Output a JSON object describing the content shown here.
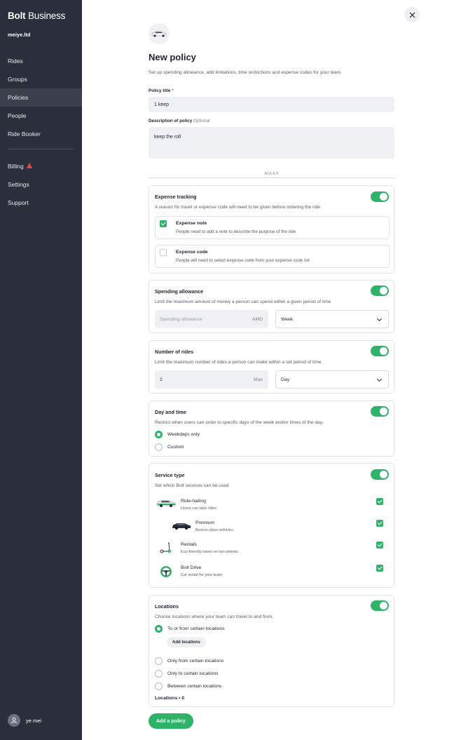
{
  "app": {
    "brand_bold": "Bolt",
    "brand_rest": " Business",
    "org": "meiye.ltd"
  },
  "sidebar": {
    "items": [
      {
        "label": "Rides"
      },
      {
        "label": "Groups"
      },
      {
        "label": "Policies",
        "active": true
      },
      {
        "label": "People"
      },
      {
        "label": "Ride Booker"
      }
    ],
    "secondary": [
      {
        "label": "Billing",
        "warning": true
      },
      {
        "label": "Settings"
      },
      {
        "label": "Support"
      }
    ],
    "user_name": "ye mei"
  },
  "page": {
    "title": "New policy",
    "subtitle": "Set up spending allowance, add limitations, time restrictions and expense codes for your team.",
    "policy_title_label": "Policy title",
    "policy_title_required": "*",
    "policy_title_value": "1 keep",
    "description_label": "Description of policy",
    "description_optional": "Optional",
    "description_value": "keep the roll",
    "rules_divider": "RULES"
  },
  "expense_tracking": {
    "title": "Expense tracking",
    "desc": "A reason for travel or expense code will need to be given before ordering the ride",
    "enabled": true,
    "options": [
      {
        "title": "Expense note",
        "desc": "People need to add a note to describe the purpose of the ride",
        "checked": true
      },
      {
        "title": "Expense code",
        "desc": "People will need to select expense code from your expense code list",
        "checked": false
      }
    ]
  },
  "spending_allowance": {
    "title": "Spending allowance",
    "desc": "Limit the maximum amount of money a person can spend within a given period of time",
    "enabled": true,
    "amount_placeholder": "Spending allowance",
    "currency": "AMD",
    "period": "Week"
  },
  "number_of_rides": {
    "title": "Number of rides",
    "desc": "Limit the maximum number of rides a person can make within a set period of time",
    "enabled": true,
    "value": "2",
    "suffix": "Max",
    "period": "Day"
  },
  "day_and_time": {
    "title": "Day and time",
    "desc": "Restrict when users can order to specific days of the week and/or times of the day.",
    "enabled": true,
    "options": [
      {
        "label": "Weekdays only",
        "selected": true
      },
      {
        "label": "Custom",
        "selected": false
      }
    ]
  },
  "service_type": {
    "title": "Service type",
    "desc": "Set which Bolt services can be used",
    "enabled": true,
    "services": [
      {
        "title": "Ride-hailing",
        "desc": "Users can take rides",
        "icon": "car-icon",
        "checked": true
      },
      {
        "title": "Premium",
        "desc": "Best-in-class vehicles",
        "icon": "premium-car-icon",
        "checked": true
      },
      {
        "title": "Rentals",
        "desc": "Eco-friendly travel on two wheels",
        "icon": "scooter-icon",
        "checked": true
      },
      {
        "title": "Bolt Drive",
        "desc": "Car rental for your team",
        "icon": "steering-wheel-icon",
        "checked": true
      }
    ]
  },
  "locations": {
    "title": "Locations",
    "desc": "Choose locations where your team can travel to and from.",
    "enabled": true,
    "options": [
      {
        "label": "To or from certain locations",
        "selected": true
      },
      {
        "label": "Only from certain locations",
        "selected": false
      },
      {
        "label": "Only to certain locations",
        "selected": false
      },
      {
        "label": "Between certain locations",
        "selected": false
      }
    ],
    "add_button": "Add locations",
    "count_label": "Locations",
    "count_value": "• 0"
  },
  "footer": {
    "submit_label": "Add a policy"
  },
  "colors": {
    "accent": "#2fb369",
    "sidebar": "#2b2f3b",
    "warning": "#e0474c"
  }
}
